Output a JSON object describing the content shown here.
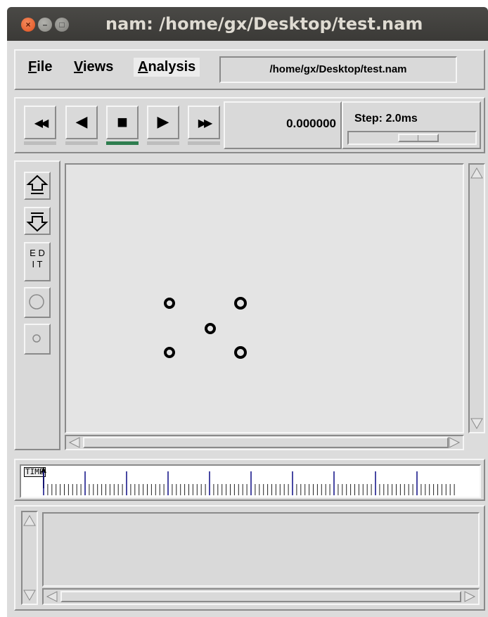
{
  "window": {
    "title": "nam: /home/gx/Desktop/test.nam",
    "controls": {
      "close": "×",
      "minimize": "–",
      "maximize": "□"
    }
  },
  "menubar": {
    "file_u": "F",
    "file_rest": "ile",
    "views_u": "V",
    "views_rest": "iews",
    "analysis_u": "A",
    "analysis_rest": "nalysis",
    "trace_path": "/home/gx/Desktop/test.nam"
  },
  "playback": {
    "rewind": "◀◀",
    "back": "◀",
    "stop": "■",
    "play": "▶",
    "fast_forward": "▶▶",
    "active_button": "stop",
    "time": "0.000000",
    "step_label": "Step: 2.0ms"
  },
  "tools": {
    "zoom_in_icon": "zoom-in-icon",
    "zoom_out_icon": "zoom-out-icon",
    "edit_line1": "E D",
    "edit_line2": "I T",
    "circle_large_icon": "circle-large-icon",
    "circle_small_icon": "circle-small-icon"
  },
  "timeline": {
    "label": "TIME"
  },
  "colors": {
    "background": "#d9d9d9",
    "titlebar": "#3f3e3b",
    "tick_major": "#1a1a8c",
    "active_indicator": "#2e7d4f",
    "node": "#000000"
  }
}
